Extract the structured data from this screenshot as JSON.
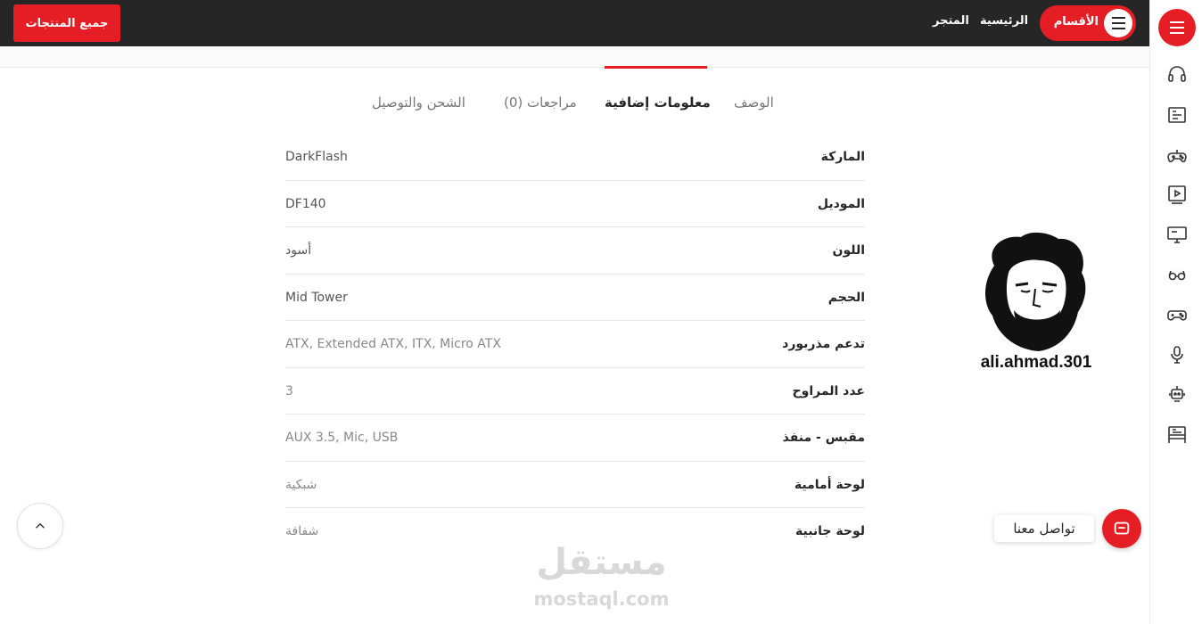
{
  "header": {
    "all_products": "جميع المنتجات",
    "categories": "الأقسام",
    "home": "الرئيسية",
    "store": "المتجر"
  },
  "tabs": [
    {
      "label": "الوصف"
    },
    {
      "label": "معلومات إضافية"
    },
    {
      "label": "مراجعات (0)"
    },
    {
      "label": "الشحن والتوصيل"
    }
  ],
  "specs": [
    {
      "key": "الماركة",
      "value": "DarkFlash"
    },
    {
      "key": "الموديل",
      "value": "DF140"
    },
    {
      "key": "اللون",
      "value": "أسود"
    },
    {
      "key": "الحجم",
      "value": "Mid Tower"
    },
    {
      "key": "تدعم مذربورد",
      "value": "ATX, Extended ATX, ITX, Micro ATX"
    },
    {
      "key": "عدد المراوح",
      "value": "3"
    },
    {
      "key": "مقبس - منفذ",
      "value": "AUX 3.5, Mic, USB"
    },
    {
      "key": "لوحة أمامية",
      "value": "شبكية"
    },
    {
      "key": "لوحة جانبية",
      "value": "شفافة"
    }
  ],
  "avatar": {
    "caption": "ali.ahmad.301"
  },
  "contact": {
    "label": "تواصل معنا"
  },
  "watermark": {
    "arabic": "مستقل",
    "latin": "mostaql.com"
  },
  "sidebar_icons": [
    "headset-icon",
    "keyboard-icon",
    "gamepad-icon",
    "monitor-play-icon",
    "monitor-icon",
    "glasses-icon",
    "controller-icon",
    "mic-icon",
    "robot-icon",
    "desk-icon"
  ],
  "colors": {
    "accent": "#e51e25",
    "topbar": "#262626"
  }
}
